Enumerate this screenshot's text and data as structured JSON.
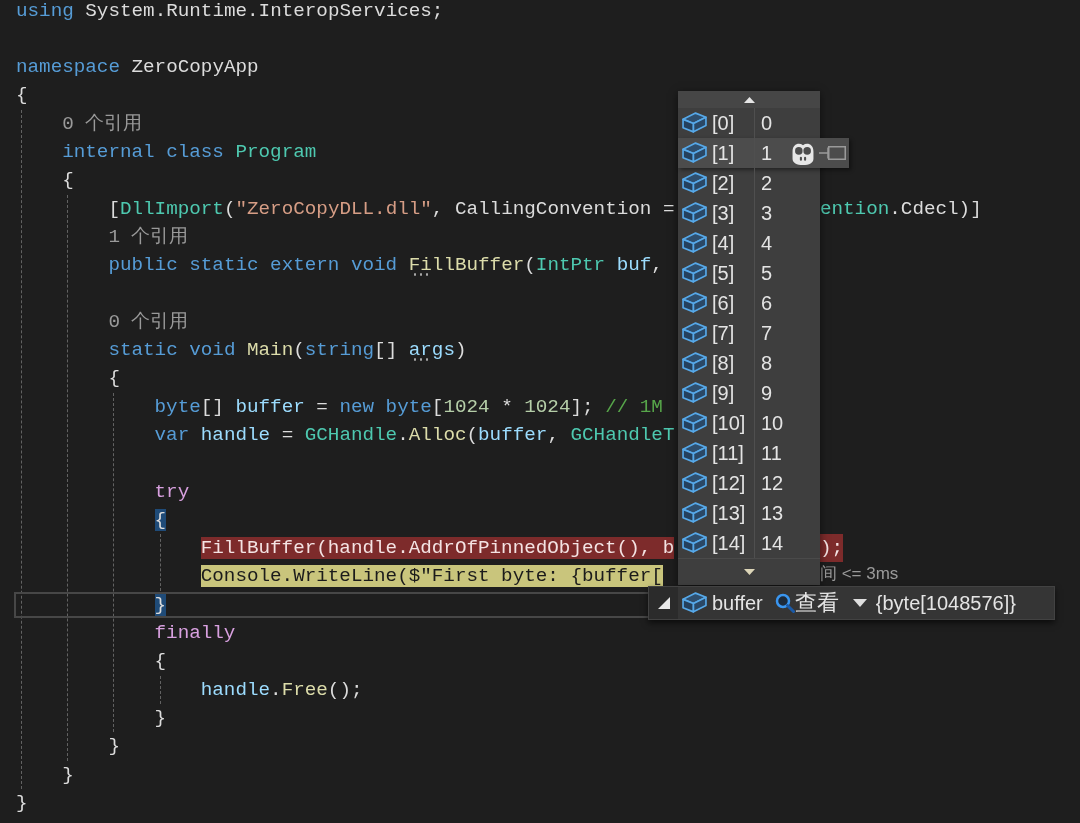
{
  "editor": {
    "lines": [
      {
        "kind": "code",
        "tokens": [
          {
            "text": "using",
            "kind": "keyword"
          },
          {
            "text": " System.Runtime.InteropServices;",
            "kind": "plain"
          }
        ]
      },
      {
        "kind": "blank"
      },
      {
        "kind": "code",
        "tokens": [
          {
            "text": "namespace",
            "kind": "keyword"
          },
          {
            "text": " ZeroCopyApp",
            "kind": "plain"
          }
        ]
      },
      {
        "kind": "code",
        "tokens": [
          {
            "text": "{",
            "kind": "plain"
          }
        ]
      },
      {
        "kind": "block",
        "children": [
          {
            "kind": "codelens",
            "text": "0 个引用"
          },
          {
            "kind": "code",
            "tokens": [
              {
                "text": "internal class ",
                "kind": "keyword"
              },
              {
                "text": "Program",
                "kind": "type"
              }
            ]
          },
          {
            "kind": "code",
            "tokens": [
              {
                "text": "{",
                "kind": "plain"
              }
            ]
          },
          {
            "kind": "block",
            "children": [
              {
                "kind": "code",
                "tokens": [
                  {
                    "text": "[",
                    "kind": "plain"
                  },
                  {
                    "text": "DllImport",
                    "kind": "type"
                  },
                  {
                    "text": "(",
                    "kind": "plain"
                  },
                  {
                    "text": "\"ZeroCopyDLL.dll\"",
                    "kind": "string"
                  },
                  {
                    "text": ", CallingConvention =",
                    "kind": "plain"
                  }
                ],
                "after_tip": [
                  {
                    "text": "ention",
                    "kind": "type"
                  },
                  {
                    "text": ".Cdecl)]",
                    "kind": "plain"
                  }
                ]
              },
              {
                "kind": "codelens",
                "text": "1 个引用"
              },
              {
                "kind": "code",
                "tokens": [
                  {
                    "text": "public static extern void ",
                    "kind": "keyword"
                  },
                  {
                    "text": "FillBuffer",
                    "kind": "method",
                    "suggestion": true
                  },
                  {
                    "text": "(",
                    "kind": "plain"
                  },
                  {
                    "text": "IntPtr ",
                    "kind": "type"
                  },
                  {
                    "text": "buf",
                    "kind": "variable"
                  },
                  {
                    "text": ",",
                    "kind": "plain"
                  }
                ]
              },
              {
                "kind": "blank"
              },
              {
                "kind": "codelens",
                "text": "0 个引用"
              },
              {
                "kind": "code",
                "tokens": [
                  {
                    "text": "static void ",
                    "kind": "keyword"
                  },
                  {
                    "text": "Main",
                    "kind": "method"
                  },
                  {
                    "text": "(",
                    "kind": "plain"
                  },
                  {
                    "text": "string",
                    "kind": "keyword"
                  },
                  {
                    "text": "[] ",
                    "kind": "plain"
                  },
                  {
                    "text": "args",
                    "kind": "variable",
                    "suggestion": true
                  },
                  {
                    "text": ")",
                    "kind": "plain"
                  }
                ]
              },
              {
                "kind": "code",
                "tokens": [
                  {
                    "text": "{",
                    "kind": "plain"
                  }
                ]
              },
              {
                "kind": "block",
                "children": [
                  {
                    "kind": "code",
                    "tokens": [
                      {
                        "text": "byte",
                        "kind": "keyword"
                      },
                      {
                        "text": "[] ",
                        "kind": "plain"
                      },
                      {
                        "text": "buffer",
                        "kind": "variable"
                      },
                      {
                        "text": " = ",
                        "kind": "plain"
                      },
                      {
                        "text": "new byte",
                        "kind": "keyword"
                      },
                      {
                        "text": "[",
                        "kind": "plain"
                      },
                      {
                        "text": "1024",
                        "kind": "number"
                      },
                      {
                        "text": " * ",
                        "kind": "plain"
                      },
                      {
                        "text": "1024",
                        "kind": "number"
                      },
                      {
                        "text": "]; ",
                        "kind": "plain"
                      },
                      {
                        "text": "// 1M",
                        "kind": "comment"
                      }
                    ]
                  },
                  {
                    "kind": "code",
                    "tokens": [
                      {
                        "text": "var ",
                        "kind": "keyword"
                      },
                      {
                        "text": "handle",
                        "kind": "variable"
                      },
                      {
                        "text": " = ",
                        "kind": "plain"
                      },
                      {
                        "text": "GCHandle",
                        "kind": "type"
                      },
                      {
                        "text": ".",
                        "kind": "plain"
                      },
                      {
                        "text": "Alloc",
                        "kind": "method"
                      },
                      {
                        "text": "(",
                        "kind": "plain"
                      },
                      {
                        "text": "buffer",
                        "kind": "variable"
                      },
                      {
                        "text": ", ",
                        "kind": "plain"
                      },
                      {
                        "text": "GCHandleT",
                        "kind": "type"
                      }
                    ]
                  },
                  {
                    "kind": "blank"
                  },
                  {
                    "kind": "code",
                    "tokens": [
                      {
                        "text": "try",
                        "kind": "control"
                      }
                    ]
                  },
                  {
                    "kind": "code",
                    "brace_match": true,
                    "tokens": [
                      {
                        "text": "{",
                        "kind": "plain"
                      }
                    ]
                  },
                  {
                    "kind": "block",
                    "children": [
                      {
                        "kind": "code",
                        "breakpoint": true,
                        "tokens": [
                          {
                            "text": "FillBuffer(handle.AddrOfPinnedObject(), b"
                          }
                        ],
                        "after_tip": [
                          {
                            "text": ");"
                          }
                        ]
                      },
                      {
                        "kind": "code",
                        "current_statement": true,
                        "tokens": [
                          {
                            "text": "Console.WriteLine($\"First byte: {buffer["
                          }
                        ],
                        "perf_tip": "间 <= 3ms"
                      }
                    ]
                  },
                  {
                    "kind": "code",
                    "brace_match": true,
                    "caret_line": true,
                    "tokens": [
                      {
                        "text": "}",
                        "kind": "plain"
                      }
                    ]
                  },
                  {
                    "kind": "code",
                    "tokens": [
                      {
                        "text": "finally",
                        "kind": "control"
                      }
                    ]
                  },
                  {
                    "kind": "code",
                    "tokens": [
                      {
                        "text": "{",
                        "kind": "plain"
                      }
                    ]
                  },
                  {
                    "kind": "block",
                    "children": [
                      {
                        "kind": "code",
                        "tokens": [
                          {
                            "text": "handle",
                            "kind": "variable"
                          },
                          {
                            "text": ".",
                            "kind": "plain"
                          },
                          {
                            "text": "Free",
                            "kind": "method"
                          },
                          {
                            "text": "();",
                            "kind": "plain"
                          }
                        ]
                      }
                    ]
                  },
                  {
                    "kind": "code",
                    "tokens": [
                      {
                        "text": "}",
                        "kind": "plain"
                      }
                    ]
                  }
                ]
              },
              {
                "kind": "code",
                "tokens": [
                  {
                    "text": "}",
                    "kind": "plain"
                  }
                ]
              }
            ]
          },
          {
            "kind": "code",
            "tokens": [
              {
                "text": "}",
                "kind": "plain"
              }
            ]
          }
        ]
      },
      {
        "kind": "code",
        "tokens": [
          {
            "text": "}",
            "kind": "plain"
          }
        ]
      }
    ]
  },
  "data_tip": {
    "items": [
      {
        "name": "[0]",
        "value": "0",
        "selected": false
      },
      {
        "name": "[1]",
        "value": "1",
        "selected": true
      },
      {
        "name": "[2]",
        "value": "2",
        "selected": false
      },
      {
        "name": "[3]",
        "value": "3",
        "selected": false
      },
      {
        "name": "[4]",
        "value": "4",
        "selected": false
      },
      {
        "name": "[5]",
        "value": "5",
        "selected": false
      },
      {
        "name": "[6]",
        "value": "6",
        "selected": false
      },
      {
        "name": "[7]",
        "value": "7",
        "selected": false
      },
      {
        "name": "[8]",
        "value": "8",
        "selected": false
      },
      {
        "name": "[9]",
        "value": "9",
        "selected": false
      },
      {
        "name": "[10]",
        "value": "10",
        "selected": false
      },
      {
        "name": "[11]",
        "value": "11",
        "selected": false
      },
      {
        "name": "[12]",
        "value": "12",
        "selected": false
      },
      {
        "name": "[13]",
        "value": "13",
        "selected": false
      },
      {
        "name": "[14]",
        "value": "14",
        "selected": false
      }
    ],
    "root": {
      "expanded": true,
      "name": "buffer",
      "visualizer": "查看",
      "value": "{byte[1048576]}"
    }
  }
}
